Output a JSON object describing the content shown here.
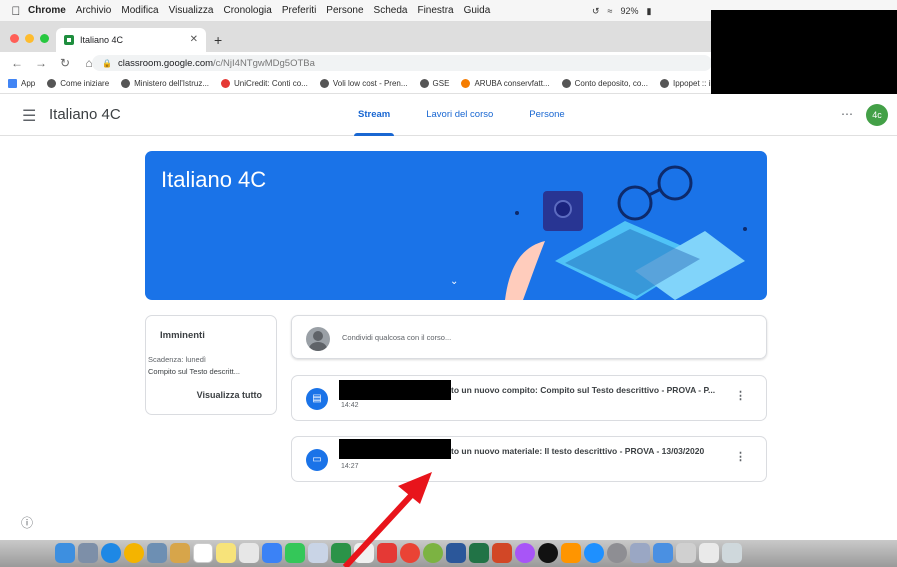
{
  "menubar": {
    "app": "Chrome",
    "items": [
      "Archivio",
      "Modifica",
      "Visualizza",
      "Cronologia",
      "Preferiti",
      "Persone",
      "Scheda",
      "Finestra",
      "Guida"
    ],
    "battery": "92%"
  },
  "browser": {
    "tab_title": "Italiano 4C",
    "url_host": "classroom.google.com",
    "url_path": "/c/NjI4NTgwMDg5OTBa",
    "bookmarks": [
      "App",
      "Come iniziare",
      "Ministero dell'Istruz...",
      "UniCredit: Conti co...",
      "Voli low cost - Pren...",
      "GSE",
      "ARUBA conservfatt...",
      "Conto deposito, co...",
      "Ippopet :: il nego"
    ]
  },
  "classroom": {
    "course_name": "Italiano 4C",
    "tabs": [
      "Stream",
      "Lavori del corso",
      "Persone"
    ],
    "avatar_text": "4c",
    "banner_title": "Italiano 4C",
    "upcoming": {
      "title": "Imminenti",
      "due": "Scadenza: lunedì",
      "item": "Compito sul Testo descritt...",
      "view_all": "Visualizza tutto"
    },
    "share_placeholder": "Condividi qualcosa con il corso...",
    "posts": [
      {
        "text": "to un nuovo compito: Compito sul Testo descrittivo - PROVA - P...",
        "time": "14:42",
        "icon": "assignment-icon"
      },
      {
        "text": "to un nuovo materiale: Il testo descrittivo - PROVA - 13/03/2020",
        "time": "14:27",
        "icon": "material-icon"
      }
    ]
  },
  "colors": {
    "accent": "#1a73e8",
    "avatar": "#43a047",
    "arrow": "#e8141b"
  }
}
